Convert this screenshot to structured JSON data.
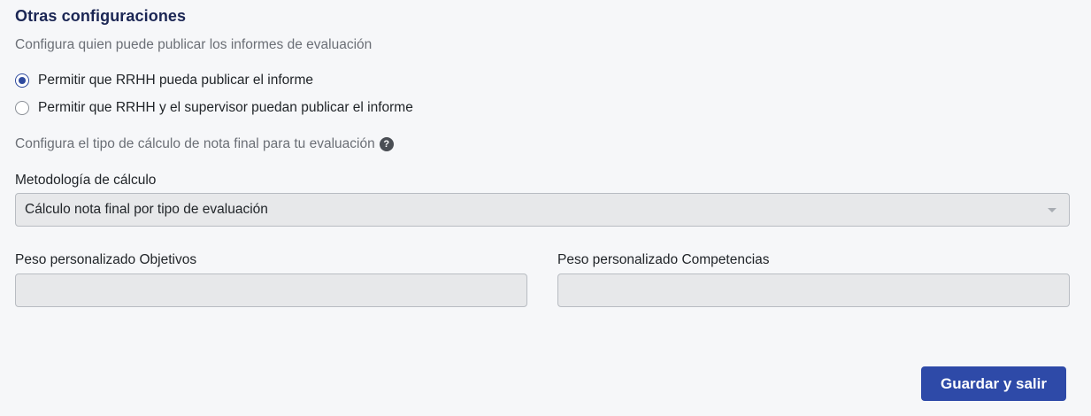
{
  "section": {
    "title": "Otras configuraciones",
    "publish_description": "Configura quien puede publicar los informes de evaluación"
  },
  "publish_options": [
    {
      "label": "Permitir que RRHH pueda publicar el informe",
      "checked": true
    },
    {
      "label": "Permitir que RRHH y el supervisor puedan publicar el informe",
      "checked": false
    }
  ],
  "calculation": {
    "description": "Configura el tipo de cálculo de nota final para tu evaluación",
    "help_icon_glyph": "?",
    "method_label": "Metodología de cálculo",
    "method_value": "Cálculo nota final por tipo de evaluación"
  },
  "weights": {
    "objectives_label": "Peso personalizado Objetivos",
    "objectives_value": "",
    "competencies_label": "Peso personalizado Competencias",
    "competencies_value": ""
  },
  "actions": {
    "save_label": "Guardar y salir"
  },
  "colors": {
    "background": "#f6f7f9",
    "title": "#1b2654",
    "accent": "#2e4aa8",
    "field_background": "#e7e8ea"
  }
}
